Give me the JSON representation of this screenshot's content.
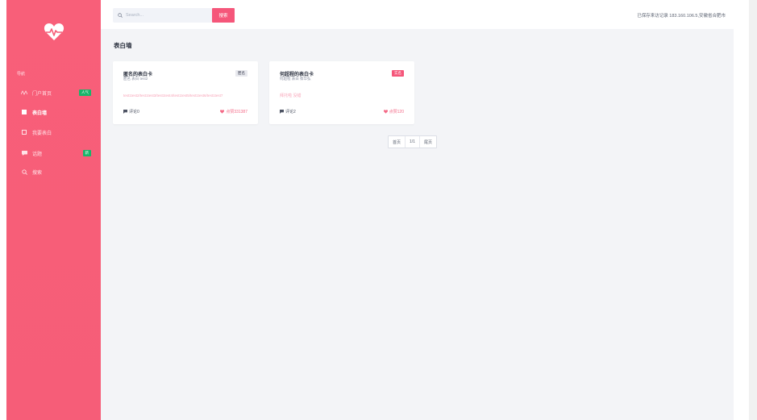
{
  "sidebar": {
    "section_label": "导航",
    "items": [
      {
        "label": "门户首页",
        "badge": "人气",
        "icon": "activity-icon"
      },
      {
        "label": "表白墙",
        "icon": "square-icon"
      },
      {
        "label": "我要表白",
        "icon": "square-outline-icon"
      },
      {
        "label": "话题",
        "badge": "新",
        "icon": "chat-icon"
      },
      {
        "label": "搜索",
        "icon": "search-icon"
      }
    ]
  },
  "search": {
    "placeholder": "Search...",
    "button_label": "搜索"
  },
  "topbar": {
    "visit_info": "已保存来访记录 183.160.106.5,安徽省合肥市"
  },
  "page": {
    "title": "表白墙"
  },
  "cards": [
    {
      "title": "匿名的表白卡",
      "subtitle": "匿名 表白 test2",
      "tag": "匿名",
      "content": "test1test2/test1test3/test1test4/test1test5/test1test6/test1test7",
      "comments": "评论0",
      "likes": "点赞331387"
    },
    {
      "title": "何超程的表白卡",
      "subtitle": "何超程 表白 蔡华弘",
      "tag": "实名",
      "content": "拜托啦 没错",
      "comments": "评论2",
      "likes": "点赞120"
    }
  ],
  "pagination": {
    "prev": "首页",
    "current": "1/1",
    "next": "尾页"
  },
  "colors": {
    "sidebar": "#f65d78",
    "accent": "#f5567a",
    "badge_green": "#19b56a",
    "tag_dark": "#3b3f52",
    "tag_pink": "#f5567a"
  }
}
